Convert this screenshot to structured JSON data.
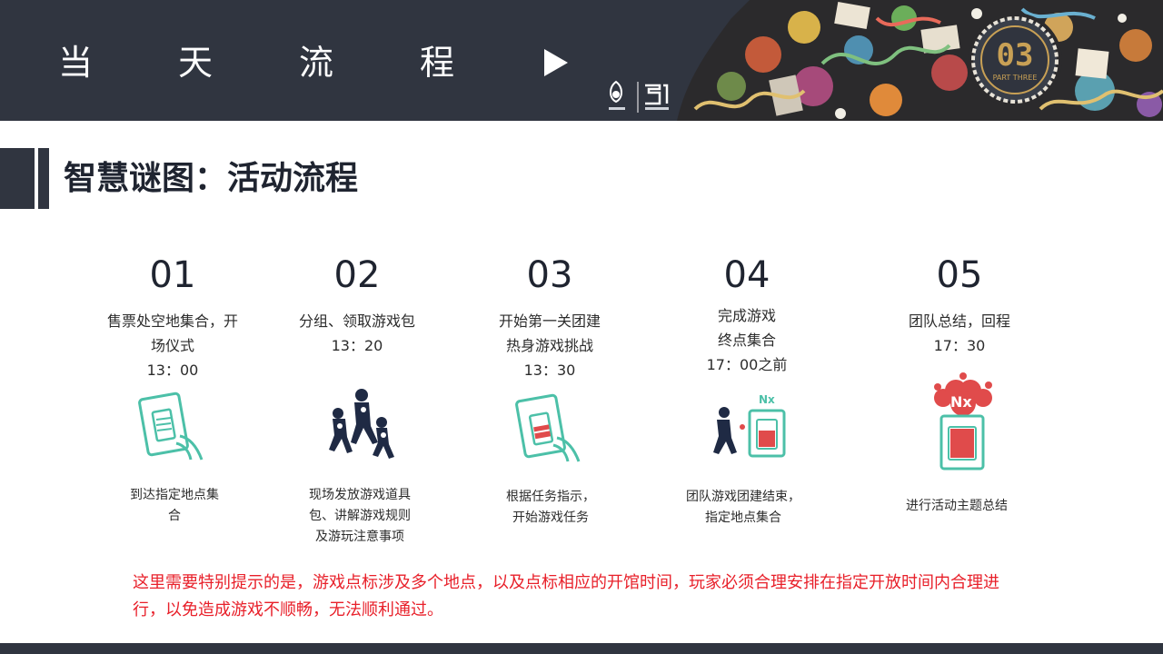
{
  "header": {
    "title_chars": [
      "当",
      "天",
      "流",
      "程"
    ],
    "part_number": "03",
    "part_label": "PART THREE",
    "colors": {
      "band": "#303540",
      "accent_gold": "#c8a055",
      "note_red": "#e8202a",
      "icon_teal": "#4cc0a8",
      "icon_red": "#e04b4b",
      "icon_navy": "#1f2a44"
    }
  },
  "section": {
    "title": "智慧谜图：活动流程"
  },
  "steps": [
    {
      "num": "01",
      "desc": "售票处空地集合，开场仪式",
      "desc_lines": [
        "售票处空地集合，开",
        "场仪式"
      ],
      "time": "13：00",
      "caption_lines": [
        "到达指定地点集",
        "合"
      ],
      "icon": "tablet-hand-icon"
    },
    {
      "num": "02",
      "desc_lines": [
        "分组、领取游戏包"
      ],
      "time": "13：20",
      "caption_lines": [
        "现场发放游戏道具",
        "包、讲解游戏规则",
        "及游玩注意事项"
      ],
      "icon": "running-team-icon"
    },
    {
      "num": "03",
      "desc_lines": [
        "开始第一关团建",
        "热身游戏挑战"
      ],
      "time": "13：30",
      "caption_lines": [
        "根据任务指示，",
        "开始游戏任务"
      ],
      "icon": "tablet-battery-icon"
    },
    {
      "num": "04",
      "desc_lines": [
        "完成游戏",
        "终点集合"
      ],
      "time": "17：00之前",
      "caption_lines": [
        "团队游戏团建结束，",
        "指定地点集合"
      ],
      "icon": "runner-battery-icon"
    },
    {
      "num": "05",
      "desc_lines": [
        "团队总结，回程"
      ],
      "time": "17：30",
      "caption_lines": [
        "进行活动主题总结"
      ],
      "icon": "battery-burst-icon"
    }
  ],
  "icon_text": {
    "nx": "Nx"
  },
  "note": "这里需要特别提示的是，游戏点标涉及多个地点，以及点标相应的开馆时间，玩家必须合理安排在指定开放时间内合理进行，以免造成游戏不顺畅，无法顺利通过。"
}
